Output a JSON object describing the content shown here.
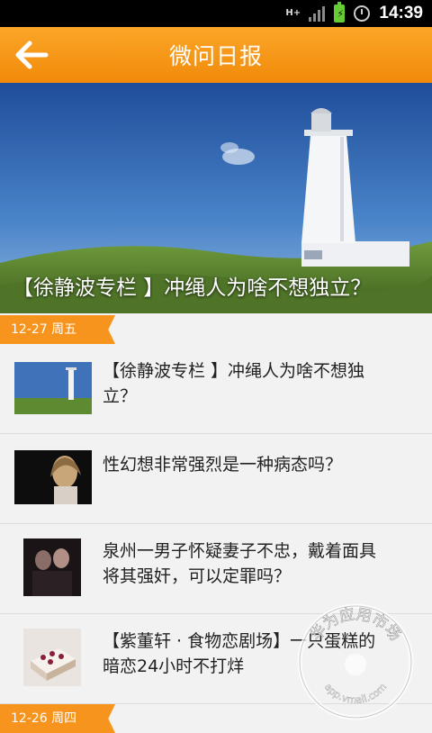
{
  "status_bar": {
    "network": "H+",
    "time": "14:39"
  },
  "header": {
    "title": "微问日报"
  },
  "hero": {
    "caption": "【徐静波专栏 】冲绳人为啥不想独立？"
  },
  "sections": [
    {
      "date": "12-27 周五",
      "items": [
        {
          "lines": [
            "【徐静波专栏 】冲绳人为啥不想独",
            "立？"
          ]
        },
        {
          "lines": [
            "性幻想非常强烈是一种病态吗？"
          ]
        },
        {
          "lines": [
            "泉州一男子怀疑妻子不忠，戴着面具",
            "将其强奸，可以定罪吗？"
          ]
        },
        {
          "lines": [
            "【紫董轩 · 食物恋剧场】一只蛋糕的",
            "暗恋24小时不打烊"
          ]
        }
      ]
    },
    {
      "date": "12-26 周四"
    }
  ],
  "watermark": {
    "brand": "华为应用市场",
    "url": "app.vmall.com"
  }
}
